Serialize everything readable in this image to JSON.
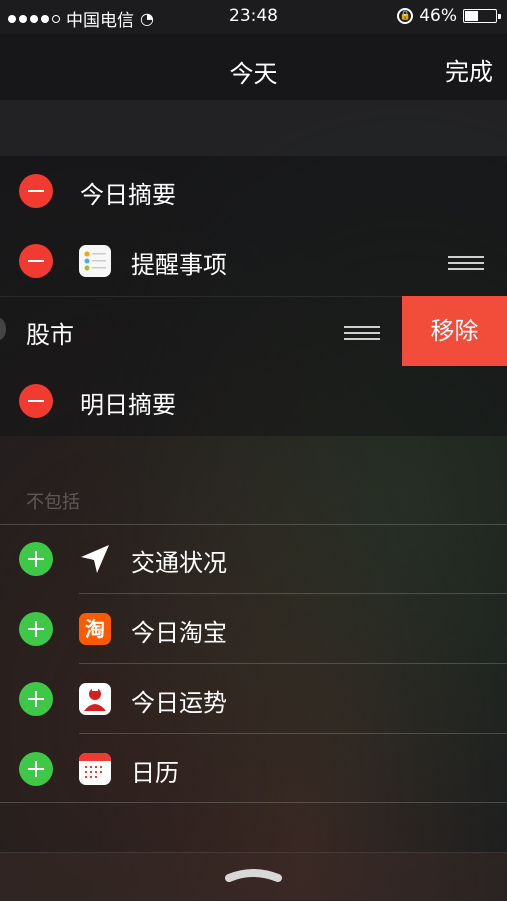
{
  "status_bar": {
    "carrier": "中国电信",
    "time": "23:48",
    "battery": "46%",
    "battery_level": 0.46
  },
  "header": {
    "title": "今天",
    "done_label": "完成"
  },
  "included": [
    {
      "label": "今日摘要",
      "icon": null
    },
    {
      "label": "提醒事项",
      "icon": "reminders-icon"
    },
    {
      "label": "股市",
      "icon": "stocks-icon"
    },
    {
      "label": "明日摘要",
      "icon": null
    }
  ],
  "remove_label": "移除",
  "excluded_section": {
    "title": "不包括",
    "items": [
      {
        "label": "交通状况",
        "icon": "location-arrow-icon"
      },
      {
        "label": "今日淘宝",
        "icon": "taobao-icon",
        "icon_text": "淘"
      },
      {
        "label": "今日运势",
        "icon": "horoscope-icon"
      },
      {
        "label": "日历",
        "icon": "calendar-icon"
      }
    ]
  },
  "colors": {
    "remove_red": "#f23b30",
    "add_green": "#3fc748",
    "taobao_orange": "#ff5a00"
  }
}
